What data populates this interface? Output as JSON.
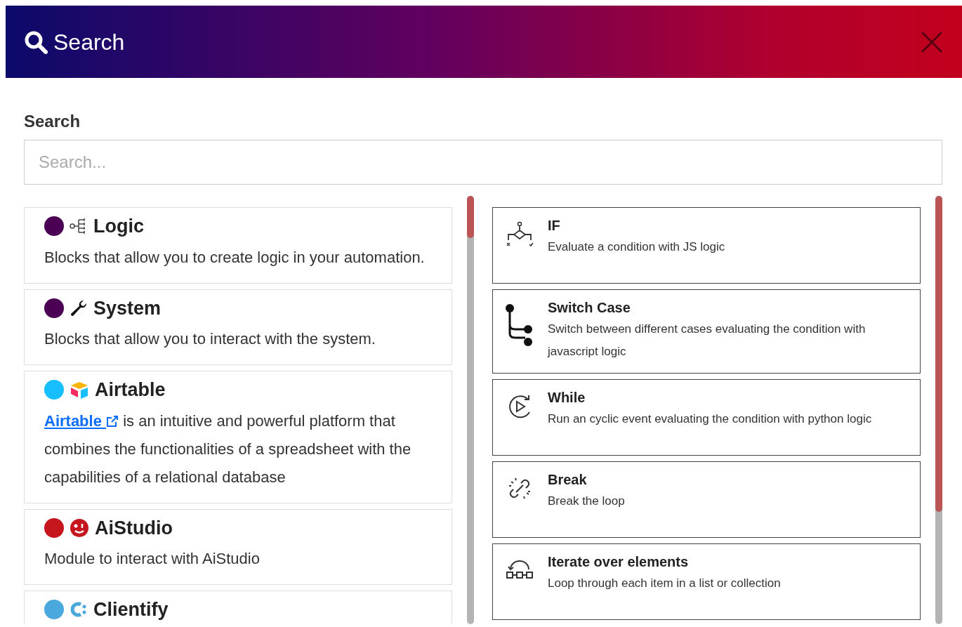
{
  "window": {
    "title": "Search"
  },
  "search": {
    "label": "Search",
    "placeholder": "Search..."
  },
  "categories": [
    {
      "kind": "logic",
      "name": "Logic",
      "color": "#4b0055",
      "description": "Blocks that allow you to create logic in your automation."
    },
    {
      "kind": "system",
      "name": "System",
      "color": "#4b0055",
      "description": "Blocks that allow you to interact with the system."
    },
    {
      "kind": "airtable",
      "name": "Airtable",
      "color": "#18bfff",
      "link": "Airtable",
      "description": "is an intuitive and powerful platform that combines the functionalities of a spreadsheet with the capabilities of a relational database"
    },
    {
      "kind": "aistudio",
      "name": "AiStudio",
      "color": "#c4161c",
      "description": "Module to interact with AiStudio"
    },
    {
      "kind": "clientify",
      "name": "Clientify",
      "color": "#4aa8dc"
    }
  ],
  "blocks": [
    {
      "kind": "if",
      "name": "IF",
      "description": "Evaluate a condition with JS logic"
    },
    {
      "kind": "switch",
      "name": "Switch Case",
      "description": "Switch between different cases evaluating the condition with javascript logic"
    },
    {
      "kind": "while",
      "name": "While",
      "description": "Run an cyclic event evaluating the condition with python logic"
    },
    {
      "kind": "break",
      "name": "Break",
      "description": "Break the loop"
    },
    {
      "kind": "iterate",
      "name": "Iterate over elements",
      "description": "Loop through each item in a list or collection"
    }
  ]
}
